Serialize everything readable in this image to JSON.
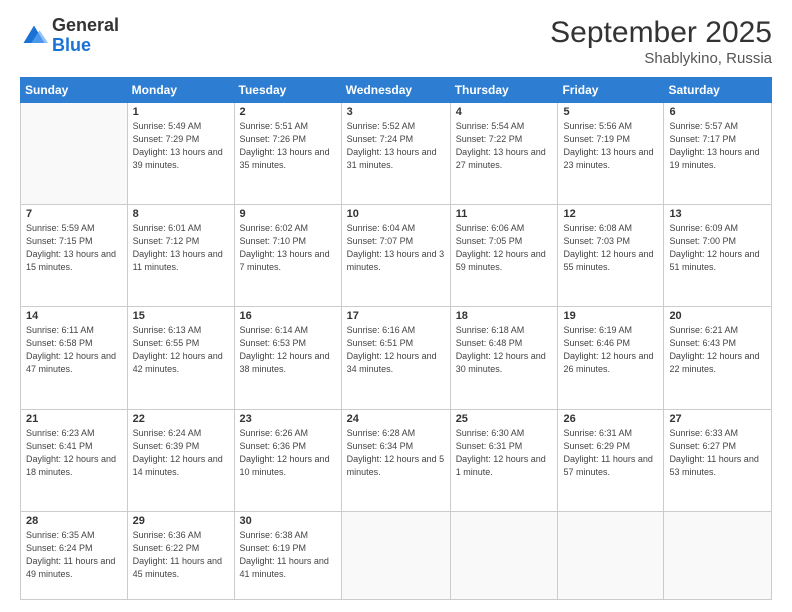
{
  "logo": {
    "general": "General",
    "blue": "Blue"
  },
  "header": {
    "month": "September 2025",
    "location": "Shablykino, Russia"
  },
  "weekdays": [
    "Sunday",
    "Monday",
    "Tuesday",
    "Wednesday",
    "Thursday",
    "Friday",
    "Saturday"
  ],
  "weeks": [
    [
      {
        "day": "",
        "sunrise": "",
        "sunset": "",
        "daylight": ""
      },
      {
        "day": "1",
        "sunrise": "Sunrise: 5:49 AM",
        "sunset": "Sunset: 7:29 PM",
        "daylight": "Daylight: 13 hours and 39 minutes."
      },
      {
        "day": "2",
        "sunrise": "Sunrise: 5:51 AM",
        "sunset": "Sunset: 7:26 PM",
        "daylight": "Daylight: 13 hours and 35 minutes."
      },
      {
        "day": "3",
        "sunrise": "Sunrise: 5:52 AM",
        "sunset": "Sunset: 7:24 PM",
        "daylight": "Daylight: 13 hours and 31 minutes."
      },
      {
        "day": "4",
        "sunrise": "Sunrise: 5:54 AM",
        "sunset": "Sunset: 7:22 PM",
        "daylight": "Daylight: 13 hours and 27 minutes."
      },
      {
        "day": "5",
        "sunrise": "Sunrise: 5:56 AM",
        "sunset": "Sunset: 7:19 PM",
        "daylight": "Daylight: 13 hours and 23 minutes."
      },
      {
        "day": "6",
        "sunrise": "Sunrise: 5:57 AM",
        "sunset": "Sunset: 7:17 PM",
        "daylight": "Daylight: 13 hours and 19 minutes."
      }
    ],
    [
      {
        "day": "7",
        "sunrise": "Sunrise: 5:59 AM",
        "sunset": "Sunset: 7:15 PM",
        "daylight": "Daylight: 13 hours and 15 minutes."
      },
      {
        "day": "8",
        "sunrise": "Sunrise: 6:01 AM",
        "sunset": "Sunset: 7:12 PM",
        "daylight": "Daylight: 13 hours and 11 minutes."
      },
      {
        "day": "9",
        "sunrise": "Sunrise: 6:02 AM",
        "sunset": "Sunset: 7:10 PM",
        "daylight": "Daylight: 13 hours and 7 minutes."
      },
      {
        "day": "10",
        "sunrise": "Sunrise: 6:04 AM",
        "sunset": "Sunset: 7:07 PM",
        "daylight": "Daylight: 13 hours and 3 minutes."
      },
      {
        "day": "11",
        "sunrise": "Sunrise: 6:06 AM",
        "sunset": "Sunset: 7:05 PM",
        "daylight": "Daylight: 12 hours and 59 minutes."
      },
      {
        "day": "12",
        "sunrise": "Sunrise: 6:08 AM",
        "sunset": "Sunset: 7:03 PM",
        "daylight": "Daylight: 12 hours and 55 minutes."
      },
      {
        "day": "13",
        "sunrise": "Sunrise: 6:09 AM",
        "sunset": "Sunset: 7:00 PM",
        "daylight": "Daylight: 12 hours and 51 minutes."
      }
    ],
    [
      {
        "day": "14",
        "sunrise": "Sunrise: 6:11 AM",
        "sunset": "Sunset: 6:58 PM",
        "daylight": "Daylight: 12 hours and 47 minutes."
      },
      {
        "day": "15",
        "sunrise": "Sunrise: 6:13 AM",
        "sunset": "Sunset: 6:55 PM",
        "daylight": "Daylight: 12 hours and 42 minutes."
      },
      {
        "day": "16",
        "sunrise": "Sunrise: 6:14 AM",
        "sunset": "Sunset: 6:53 PM",
        "daylight": "Daylight: 12 hours and 38 minutes."
      },
      {
        "day": "17",
        "sunrise": "Sunrise: 6:16 AM",
        "sunset": "Sunset: 6:51 PM",
        "daylight": "Daylight: 12 hours and 34 minutes."
      },
      {
        "day": "18",
        "sunrise": "Sunrise: 6:18 AM",
        "sunset": "Sunset: 6:48 PM",
        "daylight": "Daylight: 12 hours and 30 minutes."
      },
      {
        "day": "19",
        "sunrise": "Sunrise: 6:19 AM",
        "sunset": "Sunset: 6:46 PM",
        "daylight": "Daylight: 12 hours and 26 minutes."
      },
      {
        "day": "20",
        "sunrise": "Sunrise: 6:21 AM",
        "sunset": "Sunset: 6:43 PM",
        "daylight": "Daylight: 12 hours and 22 minutes."
      }
    ],
    [
      {
        "day": "21",
        "sunrise": "Sunrise: 6:23 AM",
        "sunset": "Sunset: 6:41 PM",
        "daylight": "Daylight: 12 hours and 18 minutes."
      },
      {
        "day": "22",
        "sunrise": "Sunrise: 6:24 AM",
        "sunset": "Sunset: 6:39 PM",
        "daylight": "Daylight: 12 hours and 14 minutes."
      },
      {
        "day": "23",
        "sunrise": "Sunrise: 6:26 AM",
        "sunset": "Sunset: 6:36 PM",
        "daylight": "Daylight: 12 hours and 10 minutes."
      },
      {
        "day": "24",
        "sunrise": "Sunrise: 6:28 AM",
        "sunset": "Sunset: 6:34 PM",
        "daylight": "Daylight: 12 hours and 5 minutes."
      },
      {
        "day": "25",
        "sunrise": "Sunrise: 6:30 AM",
        "sunset": "Sunset: 6:31 PM",
        "daylight": "Daylight: 12 hours and 1 minute."
      },
      {
        "day": "26",
        "sunrise": "Sunrise: 6:31 AM",
        "sunset": "Sunset: 6:29 PM",
        "daylight": "Daylight: 11 hours and 57 minutes."
      },
      {
        "day": "27",
        "sunrise": "Sunrise: 6:33 AM",
        "sunset": "Sunset: 6:27 PM",
        "daylight": "Daylight: 11 hours and 53 minutes."
      }
    ],
    [
      {
        "day": "28",
        "sunrise": "Sunrise: 6:35 AM",
        "sunset": "Sunset: 6:24 PM",
        "daylight": "Daylight: 11 hours and 49 minutes."
      },
      {
        "day": "29",
        "sunrise": "Sunrise: 6:36 AM",
        "sunset": "Sunset: 6:22 PM",
        "daylight": "Daylight: 11 hours and 45 minutes."
      },
      {
        "day": "30",
        "sunrise": "Sunrise: 6:38 AM",
        "sunset": "Sunset: 6:19 PM",
        "daylight": "Daylight: 11 hours and 41 minutes."
      },
      {
        "day": "",
        "sunrise": "",
        "sunset": "",
        "daylight": ""
      },
      {
        "day": "",
        "sunrise": "",
        "sunset": "",
        "daylight": ""
      },
      {
        "day": "",
        "sunrise": "",
        "sunset": "",
        "daylight": ""
      },
      {
        "day": "",
        "sunrise": "",
        "sunset": "",
        "daylight": ""
      }
    ]
  ]
}
